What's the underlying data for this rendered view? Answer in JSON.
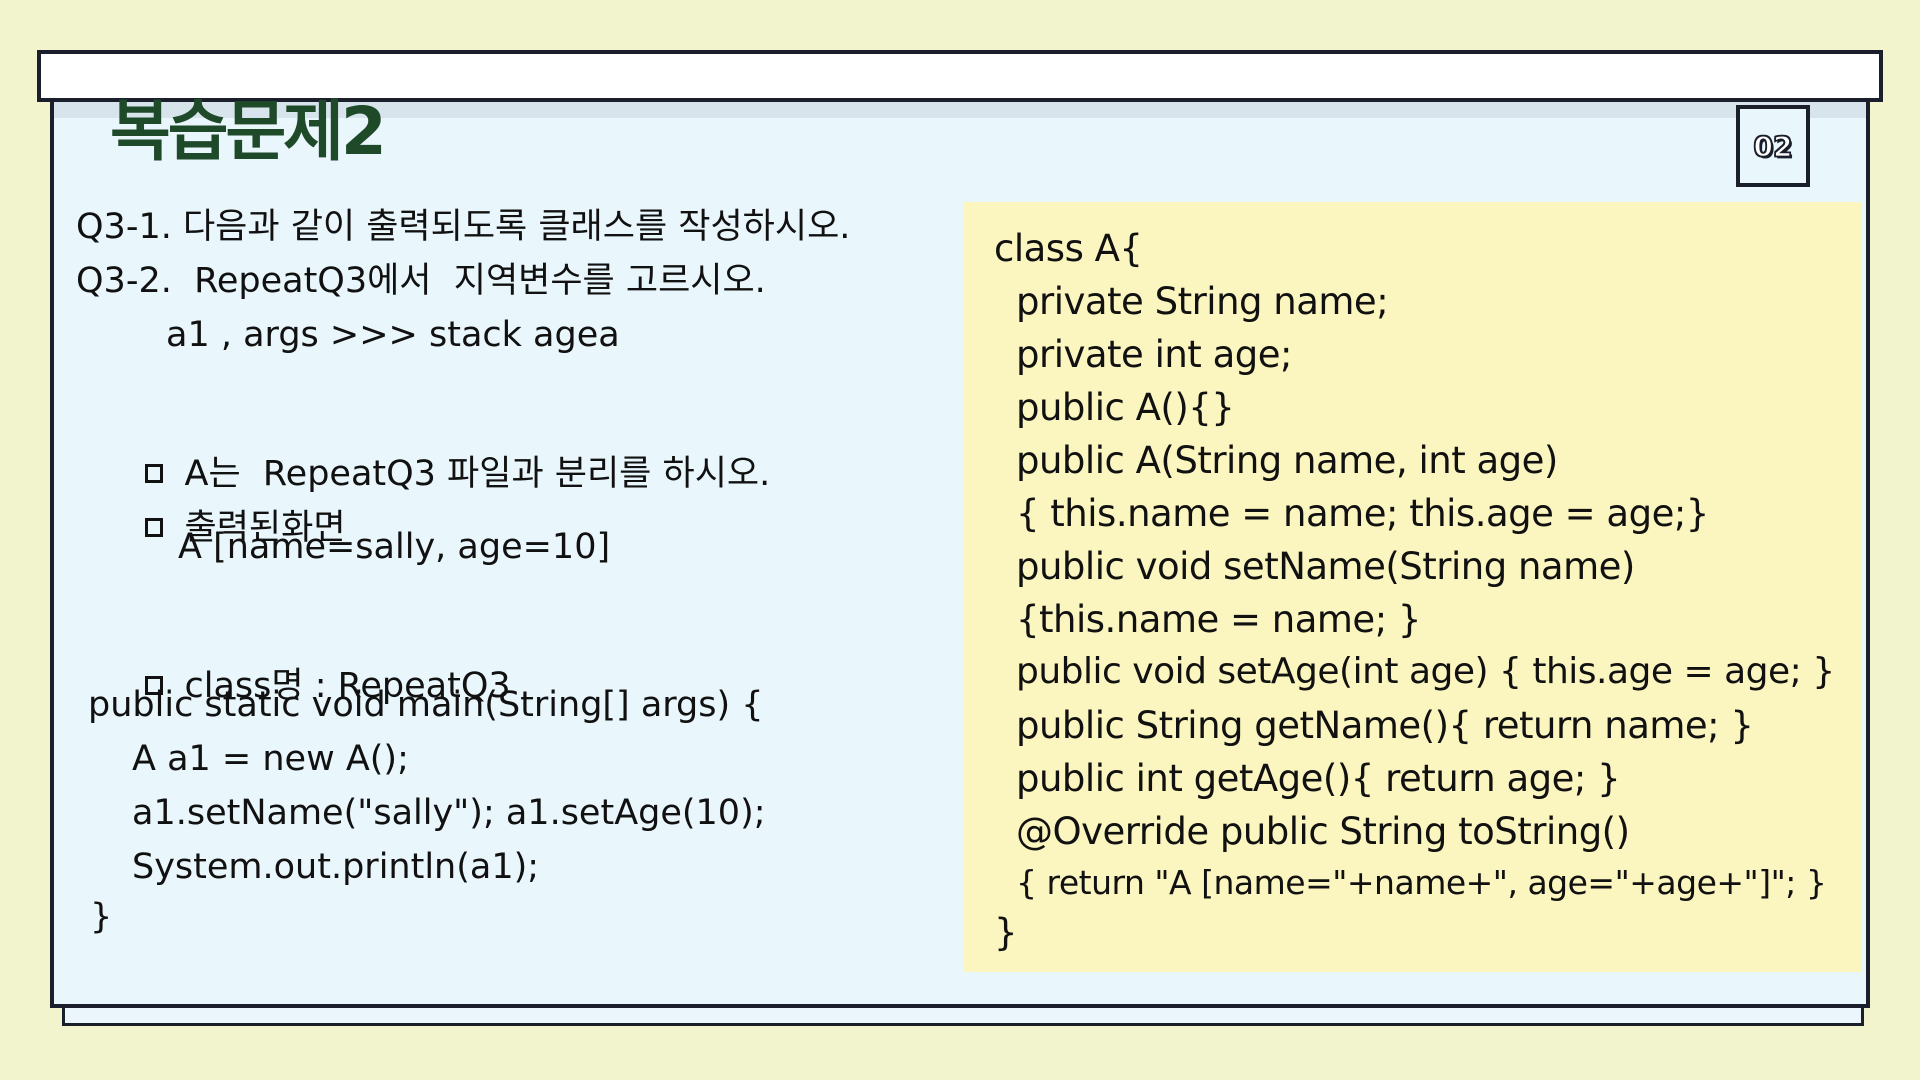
{
  "title": "복습문제2",
  "badge": "02",
  "left_lines": [
    "Q3-1. 다음과 같이 출력되도록 클래스를 작성하시오.",
    "Q3-2.  RepeatQ3에서  지역변수를 고르시오.",
    "a1 , args >>> stack agea"
  ],
  "bullets": [
    "A는  RepeatQ3 파일과 분리를 하시오.",
    "출력된화면",
    "class명 : RepeatQ3"
  ],
  "output_value": "A [name=sally, age=10]",
  "main_code": [
    "public static void main(String[] args) {",
    "A a1 = new A();",
    "a1.setName(\"sally\"); a1.setAge(10);",
    "System.out.println(a1);",
    "}"
  ],
  "class_code": [
    "class A{",
    "private String name;",
    "private int age;",
    "public A(){}",
    "public A(String name, int age)",
    "{ this.name = name; this.age = age;}",
    "public void setName(String name)",
    "{this.name = name; }",
    "public void setAge(int age) { this.age = age; }",
    "public String getName(){ return name; }",
    "public int getAge(){ return age; }",
    "@Override public String toString()",
    "{ return \"A [name=\"+name+\", age=\"+age+\"]\"; }",
    "}"
  ],
  "colors": {
    "background": "#f1f4cc",
    "board": "#e9f6fc",
    "code_panel": "#fbf5bf",
    "title": "#1f4a2a",
    "border": "#1b1f2b"
  }
}
